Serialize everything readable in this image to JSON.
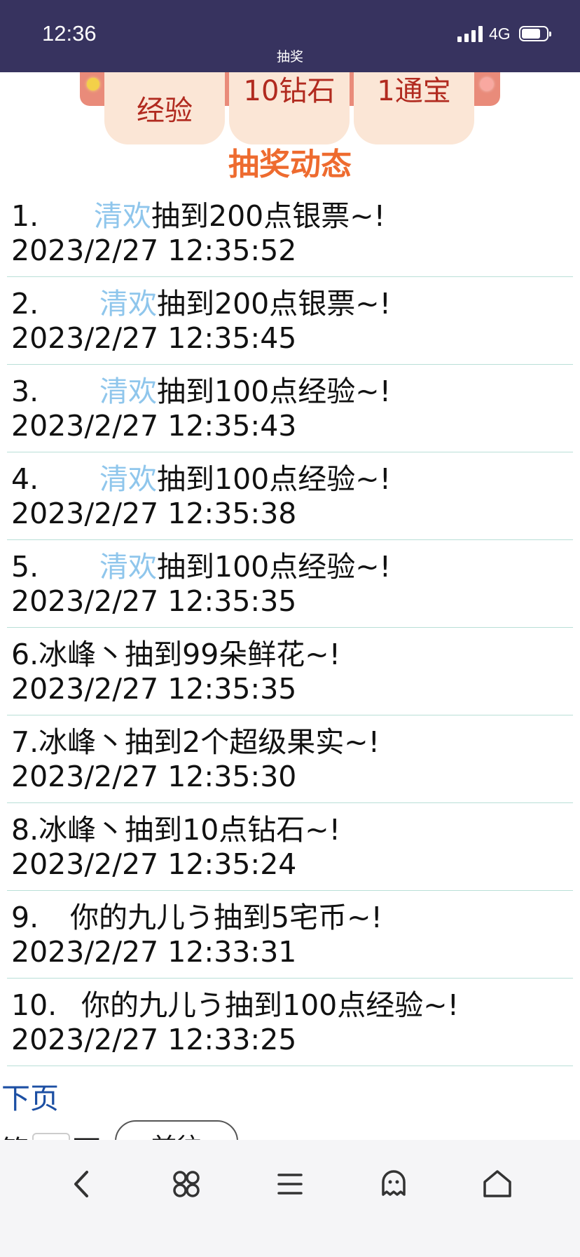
{
  "status_bar": {
    "time": "12:36",
    "network": "4G",
    "page_title": "抽奖"
  },
  "prizes": [
    {
      "label": "经验"
    },
    {
      "label": "10钻石"
    },
    {
      "label": "1通宝"
    }
  ],
  "section_title": "抽奖动态",
  "feed": [
    {
      "rank": "1.",
      "user": "清欢",
      "text": "抽到200点银票~!",
      "time": "2023/2/27 12:35:52"
    },
    {
      "rank": "2.",
      "user": "清欢",
      "text": "抽到200点银票~!",
      "time": "2023/2/27 12:35:45"
    },
    {
      "rank": "3.",
      "user": "清欢",
      "text": "抽到100点经验~!",
      "time": "2023/2/27 12:35:43"
    },
    {
      "rank": "4.",
      "user": "清欢",
      "text": "抽到100点经验~!",
      "time": "2023/2/27 12:35:38"
    },
    {
      "rank": "5.",
      "user": "清欢",
      "text": "抽到100点经验~!",
      "time": "2023/2/27 12:35:35"
    },
    {
      "rank": "6.",
      "user": "冰峰丶",
      "text": "抽到99朵鲜花~!",
      "time": "2023/2/27 12:35:35"
    },
    {
      "rank": "7.",
      "user": "冰峰丶",
      "text": "抽到2个超级果实~!",
      "time": "2023/2/27 12:35:30"
    },
    {
      "rank": "8.",
      "user": "冰峰丶",
      "text": "抽到10点钻石~!",
      "time": "2023/2/27 12:35:24"
    },
    {
      "rank": "9.",
      "user": "你的九儿う",
      "text": "抽到5宅币~!",
      "time": "2023/2/27 12:33:31"
    },
    {
      "rank": "10.",
      "user": "你的九儿う",
      "text": "抽到100点经验~!",
      "time": "2023/2/27 12:33:25"
    }
  ],
  "pagination": {
    "next_label": "下页",
    "page_prefix": "第",
    "page_suffix": "页",
    "jump_button": "前往"
  },
  "toolbar": {
    "icons": [
      "back-icon",
      "command-icon",
      "menu-icon",
      "ghost-icon",
      "home-icon"
    ]
  }
}
